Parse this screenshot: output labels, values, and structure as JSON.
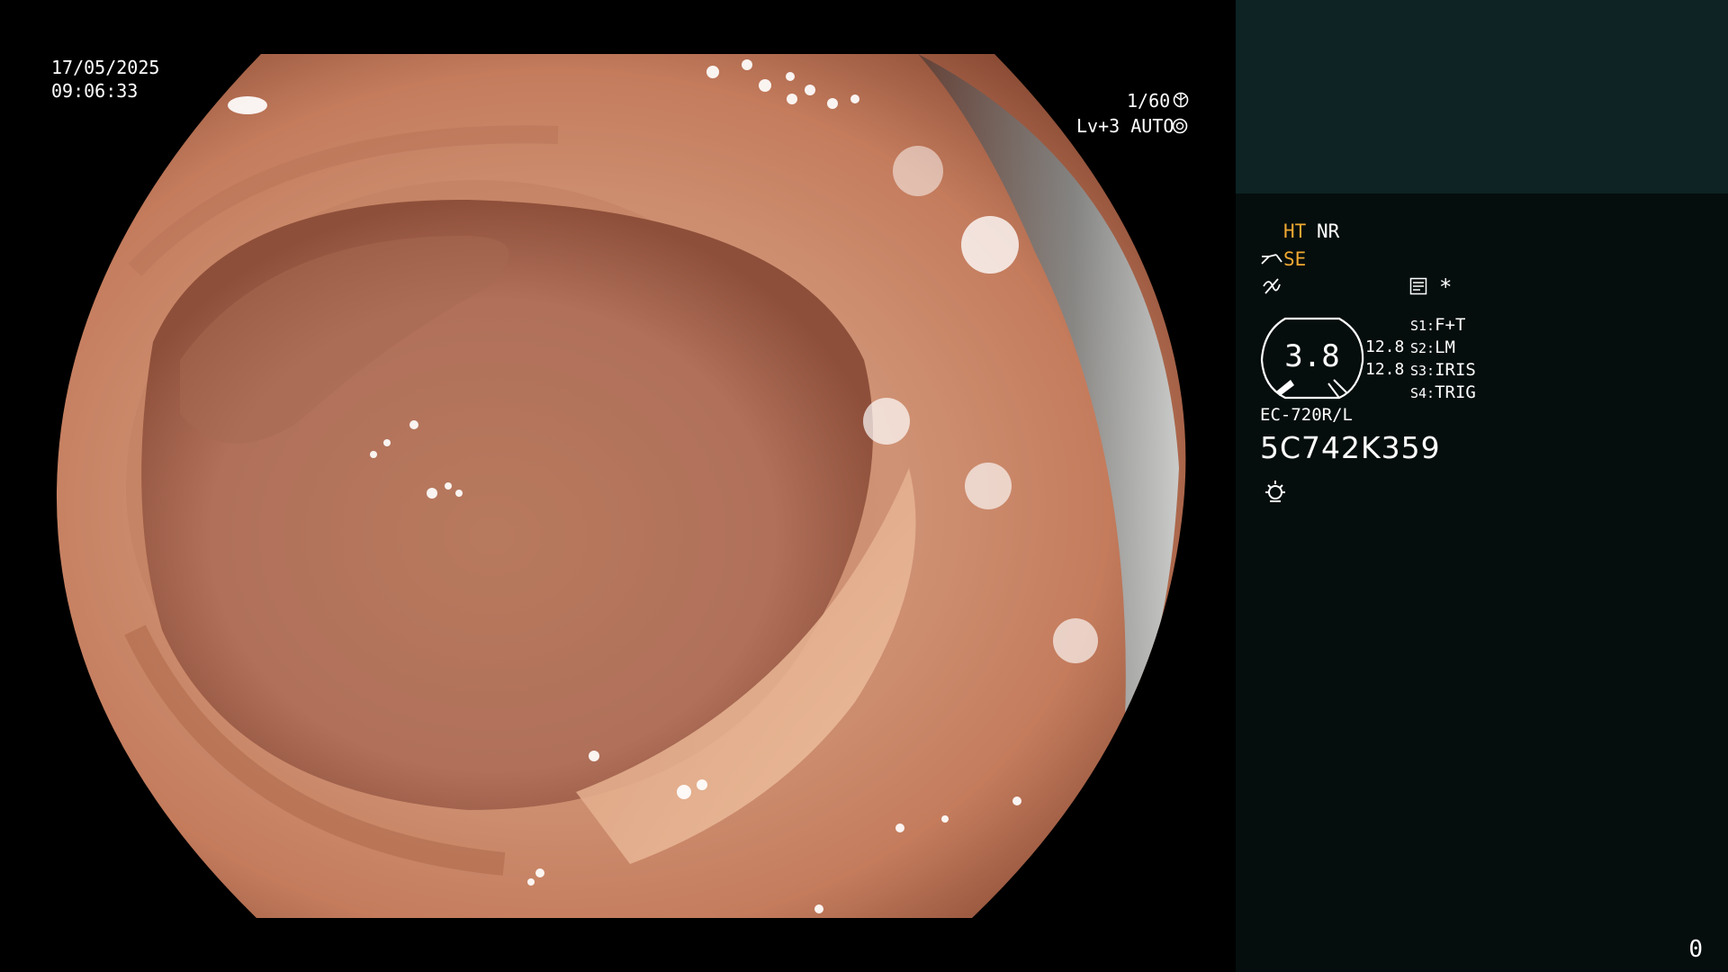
{
  "overlay": {
    "date": "17/05/2025",
    "time": "09:06:33",
    "shutter": "1/60",
    "level": "Lv+3 AUTO"
  },
  "status": {
    "ht": "HT",
    "nr": "NR",
    "se": "SE",
    "asterisk": "*"
  },
  "gauge": {
    "value": "3.8",
    "left_top": "12.8",
    "left_bottom": "12.8"
  },
  "switches": [
    {
      "key": "S1:",
      "value": "F+T"
    },
    {
      "key": "S2:",
      "value": "LM"
    },
    {
      "key": "S3:",
      "value": "IRIS"
    },
    {
      "key": "S4:",
      "value": "TRIG"
    }
  ],
  "scope": {
    "model": "EC-720R/L",
    "serial": "5C742K359"
  },
  "counter": "0",
  "colors": {
    "sidebar_top": "#0d2324",
    "sidebar_bottom": "#050e0d",
    "accent": "#f1a832"
  },
  "icons": [
    "shutter-icon",
    "auto-exposure-icon",
    "scope-angle-icon",
    "signal-icon",
    "memo-icon",
    "light-source-icon"
  ]
}
